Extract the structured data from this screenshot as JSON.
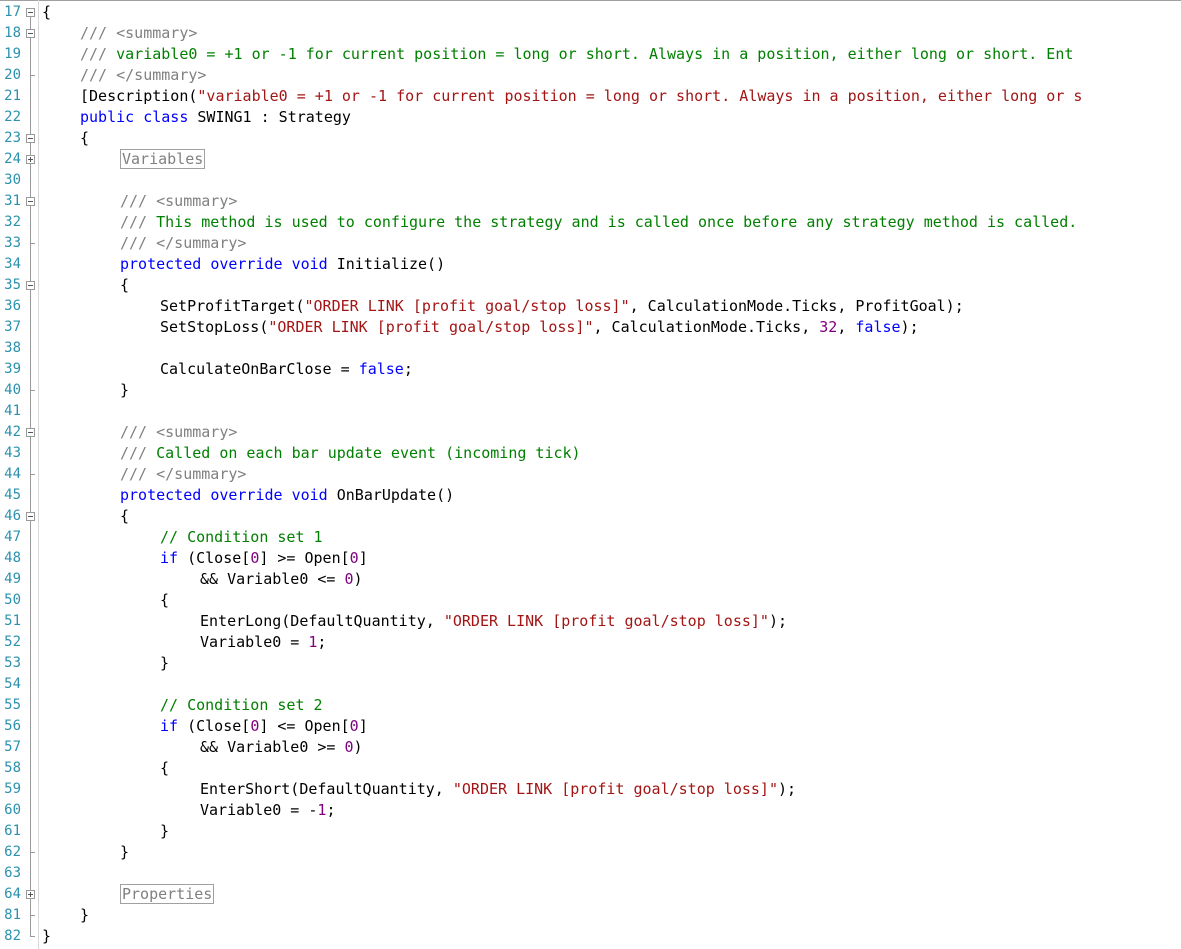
{
  "editor": {
    "language": "C#",
    "colors": {
      "keyword": "#0000ff",
      "string": "#a31515",
      "comment": "#008000",
      "doc_tag": "#808080",
      "number": "#800080",
      "line_number": "#2b91af"
    },
    "lines": [
      {
        "num": "17",
        "indent": 0,
        "fold": "open",
        "tokens": [
          {
            "t": "{",
            "c": ""
          }
        ]
      },
      {
        "num": "18",
        "indent": 1,
        "fold": "open",
        "tokens": [
          {
            "t": "/// ",
            "c": "doc"
          },
          {
            "t": "<summary>",
            "c": "doc"
          }
        ]
      },
      {
        "num": "19",
        "indent": 1,
        "fold": "line",
        "tokens": [
          {
            "t": "/// ",
            "c": "doc"
          },
          {
            "t": "variable0 = +1 or -1 for current position = long or short. Always in a position, either long or short. Ent",
            "c": "cm"
          }
        ]
      },
      {
        "num": "20",
        "indent": 1,
        "fold": "end",
        "tokens": [
          {
            "t": "/// ",
            "c": "doc"
          },
          {
            "t": "</summary>",
            "c": "doc"
          }
        ]
      },
      {
        "num": "21",
        "indent": 1,
        "fold": "line",
        "tokens": [
          {
            "t": "[Description(",
            "c": ""
          },
          {
            "t": "\"variable0 = +1 or -1 for current position = long or short. Always in a position, either long or s",
            "c": "str"
          }
        ]
      },
      {
        "num": "22",
        "indent": 1,
        "fold": "line",
        "tokens": [
          {
            "t": "public",
            "c": "kw"
          },
          {
            "t": " ",
            "c": ""
          },
          {
            "t": "class",
            "c": "kw"
          },
          {
            "t": " SWING1 : Strategy",
            "c": ""
          }
        ]
      },
      {
        "num": "23",
        "indent": 1,
        "fold": "open",
        "tokens": [
          {
            "t": "{",
            "c": ""
          }
        ]
      },
      {
        "num": "24",
        "indent": 2,
        "fold": "closed",
        "tokens": [
          {
            "t": "Variables",
            "c": "region"
          }
        ]
      },
      {
        "num": "30",
        "indent": 0,
        "fold": "line",
        "tokens": []
      },
      {
        "num": "31",
        "indent": 2,
        "fold": "open",
        "tokens": [
          {
            "t": "/// ",
            "c": "doc"
          },
          {
            "t": "<summary>",
            "c": "doc"
          }
        ]
      },
      {
        "num": "32",
        "indent": 2,
        "fold": "line",
        "tokens": [
          {
            "t": "/// ",
            "c": "doc"
          },
          {
            "t": "This method is used to configure the strategy and is called once before any strategy method is called.",
            "c": "cm"
          }
        ]
      },
      {
        "num": "33",
        "indent": 2,
        "fold": "end",
        "tokens": [
          {
            "t": "/// ",
            "c": "doc"
          },
          {
            "t": "</summary>",
            "c": "doc"
          }
        ]
      },
      {
        "num": "34",
        "indent": 2,
        "fold": "line",
        "tokens": [
          {
            "t": "protected",
            "c": "kw"
          },
          {
            "t": " ",
            "c": ""
          },
          {
            "t": "override",
            "c": "kw"
          },
          {
            "t": " ",
            "c": ""
          },
          {
            "t": "void",
            "c": "kw"
          },
          {
            "t": " Initialize()",
            "c": ""
          }
        ]
      },
      {
        "num": "35",
        "indent": 2,
        "fold": "open",
        "tokens": [
          {
            "t": "{",
            "c": ""
          }
        ]
      },
      {
        "num": "36",
        "indent": 3,
        "fold": "line",
        "tokens": [
          {
            "t": "SetProfitTarget(",
            "c": ""
          },
          {
            "t": "\"ORDER LINK [profit goal/stop loss]\"",
            "c": "str"
          },
          {
            "t": ", CalculationMode.Ticks, ProfitGoal);",
            "c": ""
          }
        ]
      },
      {
        "num": "37",
        "indent": 3,
        "fold": "line",
        "tokens": [
          {
            "t": "SetStopLoss(",
            "c": ""
          },
          {
            "t": "\"ORDER LINK [profit goal/stop loss]\"",
            "c": "str"
          },
          {
            "t": ", CalculationMode.Ticks, ",
            "c": ""
          },
          {
            "t": "32",
            "c": "num"
          },
          {
            "t": ", ",
            "c": ""
          },
          {
            "t": "false",
            "c": "kw"
          },
          {
            "t": ");",
            "c": ""
          }
        ]
      },
      {
        "num": "38",
        "indent": 0,
        "fold": "line",
        "tokens": []
      },
      {
        "num": "39",
        "indent": 3,
        "fold": "line",
        "tokens": [
          {
            "t": "CalculateOnBarClose = ",
            "c": ""
          },
          {
            "t": "false",
            "c": "kw"
          },
          {
            "t": ";",
            "c": ""
          }
        ]
      },
      {
        "num": "40",
        "indent": 2,
        "fold": "end",
        "tokens": [
          {
            "t": "}",
            "c": ""
          }
        ]
      },
      {
        "num": "41",
        "indent": 0,
        "fold": "line",
        "tokens": []
      },
      {
        "num": "42",
        "indent": 2,
        "fold": "open",
        "tokens": [
          {
            "t": "/// ",
            "c": "doc"
          },
          {
            "t": "<summary>",
            "c": "doc"
          }
        ]
      },
      {
        "num": "43",
        "indent": 2,
        "fold": "line",
        "tokens": [
          {
            "t": "/// ",
            "c": "doc"
          },
          {
            "t": "Called on each bar update event (incoming tick)",
            "c": "cm"
          }
        ]
      },
      {
        "num": "44",
        "indent": 2,
        "fold": "end",
        "tokens": [
          {
            "t": "/// ",
            "c": "doc"
          },
          {
            "t": "</summary>",
            "c": "doc"
          }
        ]
      },
      {
        "num": "45",
        "indent": 2,
        "fold": "line",
        "tokens": [
          {
            "t": "protected",
            "c": "kw"
          },
          {
            "t": " ",
            "c": ""
          },
          {
            "t": "override",
            "c": "kw"
          },
          {
            "t": " ",
            "c": ""
          },
          {
            "t": "void",
            "c": "kw"
          },
          {
            "t": " OnBarUpdate()",
            "c": ""
          }
        ]
      },
      {
        "num": "46",
        "indent": 2,
        "fold": "open",
        "tokens": [
          {
            "t": "{",
            "c": ""
          }
        ]
      },
      {
        "num": "47",
        "indent": 3,
        "fold": "line",
        "tokens": [
          {
            "t": "// Condition set 1",
            "c": "cm"
          }
        ]
      },
      {
        "num": "48",
        "indent": 3,
        "fold": "line",
        "tokens": [
          {
            "t": "if",
            "c": "kw"
          },
          {
            "t": " (Close[",
            "c": ""
          },
          {
            "t": "0",
            "c": "num"
          },
          {
            "t": "] >= Open[",
            "c": ""
          },
          {
            "t": "0",
            "c": "num"
          },
          {
            "t": "]",
            "c": ""
          }
        ]
      },
      {
        "num": "49",
        "indent": 4,
        "fold": "line",
        "tokens": [
          {
            "t": "&& Variable0 <= ",
            "c": ""
          },
          {
            "t": "0",
            "c": "num"
          },
          {
            "t": ")",
            "c": ""
          }
        ]
      },
      {
        "num": "50",
        "indent": 3,
        "fold": "line",
        "tokens": [
          {
            "t": "{",
            "c": ""
          }
        ]
      },
      {
        "num": "51",
        "indent": 4,
        "fold": "line",
        "tokens": [
          {
            "t": "EnterLong(DefaultQuantity, ",
            "c": ""
          },
          {
            "t": "\"ORDER LINK [profit goal/stop loss]\"",
            "c": "str"
          },
          {
            "t": ");",
            "c": ""
          }
        ]
      },
      {
        "num": "52",
        "indent": 4,
        "fold": "line",
        "tokens": [
          {
            "t": "Variable0 = ",
            "c": ""
          },
          {
            "t": "1",
            "c": "num"
          },
          {
            "t": ";",
            "c": ""
          }
        ]
      },
      {
        "num": "53",
        "indent": 3,
        "fold": "line",
        "tokens": [
          {
            "t": "}",
            "c": ""
          }
        ]
      },
      {
        "num": "54",
        "indent": 0,
        "fold": "line",
        "tokens": []
      },
      {
        "num": "55",
        "indent": 3,
        "fold": "line",
        "tokens": [
          {
            "t": "// Condition set 2",
            "c": "cm"
          }
        ]
      },
      {
        "num": "56",
        "indent": 3,
        "fold": "line",
        "tokens": [
          {
            "t": "if",
            "c": "kw"
          },
          {
            "t": " (Close[",
            "c": ""
          },
          {
            "t": "0",
            "c": "num"
          },
          {
            "t": "] <= Open[",
            "c": ""
          },
          {
            "t": "0",
            "c": "num"
          },
          {
            "t": "]",
            "c": ""
          }
        ]
      },
      {
        "num": "57",
        "indent": 4,
        "fold": "line",
        "tokens": [
          {
            "t": "&& Variable0 >= ",
            "c": ""
          },
          {
            "t": "0",
            "c": "num"
          },
          {
            "t": ")",
            "c": ""
          }
        ]
      },
      {
        "num": "58",
        "indent": 3,
        "fold": "line",
        "tokens": [
          {
            "t": "{",
            "c": ""
          }
        ]
      },
      {
        "num": "59",
        "indent": 4,
        "fold": "line",
        "tokens": [
          {
            "t": "EnterShort(DefaultQuantity, ",
            "c": ""
          },
          {
            "t": "\"ORDER LINK [profit goal/stop loss]\"",
            "c": "str"
          },
          {
            "t": ");",
            "c": ""
          }
        ]
      },
      {
        "num": "60",
        "indent": 4,
        "fold": "line",
        "tokens": [
          {
            "t": "Variable0 = -",
            "c": ""
          },
          {
            "t": "1",
            "c": "num"
          },
          {
            "t": ";",
            "c": ""
          }
        ]
      },
      {
        "num": "61",
        "indent": 3,
        "fold": "line",
        "tokens": [
          {
            "t": "}",
            "c": ""
          }
        ]
      },
      {
        "num": "62",
        "indent": 2,
        "fold": "end",
        "tokens": [
          {
            "t": "}",
            "c": ""
          }
        ]
      },
      {
        "num": "63",
        "indent": 0,
        "fold": "line",
        "tokens": []
      },
      {
        "num": "64",
        "indent": 2,
        "fold": "closed",
        "tokens": [
          {
            "t": "Properties",
            "c": "region"
          }
        ]
      },
      {
        "num": "81",
        "indent": 1,
        "fold": "end",
        "tokens": [
          {
            "t": "}",
            "c": ""
          }
        ]
      },
      {
        "num": "82",
        "indent": 0,
        "fold": "end",
        "tokens": [
          {
            "t": "}",
            "c": ""
          }
        ]
      }
    ]
  }
}
